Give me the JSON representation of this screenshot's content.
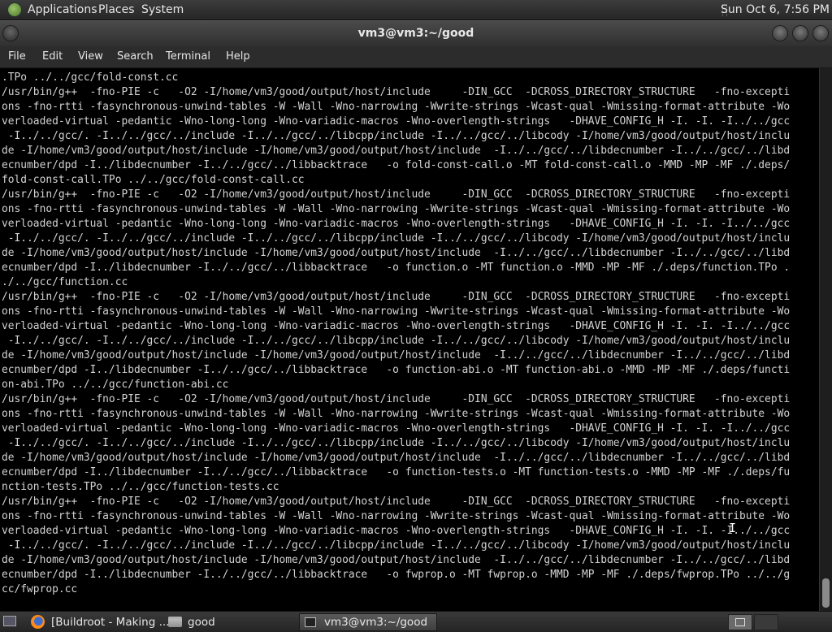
{
  "top_panel": {
    "applications": "Applications",
    "places": "Places",
    "system": "System",
    "clock": "Sun Oct  6,  7:56 PM"
  },
  "window": {
    "title": "vm3@vm3:~/good"
  },
  "menubar": {
    "file": "File",
    "edit": "Edit",
    "view": "View",
    "search": "Search",
    "terminal": "Terminal",
    "help": "Help"
  },
  "terminal": {
    "output": ".TPo ../../gcc/fold-const.cc\n/usr/bin/g++  -fno-PIE -c   -O2 -I/home/vm3/good/output/host/include     -DIN_GCC  -DCROSS_DIRECTORY_STRUCTURE   -fno-excepti\nons -fno-rtti -fasynchronous-unwind-tables -W -Wall -Wno-narrowing -Wwrite-strings -Wcast-qual -Wmissing-format-attribute -Wo\nverloaded-virtual -pedantic -Wno-long-long -Wno-variadic-macros -Wno-overlength-strings   -DHAVE_CONFIG_H -I. -I. -I../../gcc\n -I../../gcc/. -I../../gcc/../include -I../../gcc/../libcpp/include -I../../gcc/../libcody -I/home/vm3/good/output/host/inclu\nde -I/home/vm3/good/output/host/include -I/home/vm3/good/output/host/include  -I../../gcc/../libdecnumber -I../../gcc/../libd\necnumber/dpd -I../libdecnumber -I../../gcc/../libbacktrace   -o fold-const-call.o -MT fold-const-call.o -MMD -MP -MF ./.deps/\nfold-const-call.TPo ../../gcc/fold-const-call.cc\n/usr/bin/g++  -fno-PIE -c   -O2 -I/home/vm3/good/output/host/include     -DIN_GCC  -DCROSS_DIRECTORY_STRUCTURE   -fno-excepti\nons -fno-rtti -fasynchronous-unwind-tables -W -Wall -Wno-narrowing -Wwrite-strings -Wcast-qual -Wmissing-format-attribute -Wo\nverloaded-virtual -pedantic -Wno-long-long -Wno-variadic-macros -Wno-overlength-strings   -DHAVE_CONFIG_H -I. -I. -I../../gcc\n -I../../gcc/. -I../../gcc/../include -I../../gcc/../libcpp/include -I../../gcc/../libcody -I/home/vm3/good/output/host/inclu\nde -I/home/vm3/good/output/host/include -I/home/vm3/good/output/host/include  -I../../gcc/../libdecnumber -I../../gcc/../libd\necnumber/dpd -I../libdecnumber -I../../gcc/../libbacktrace   -o function.o -MT function.o -MMD -MP -MF ./.deps/function.TPo .\n./../gcc/function.cc\n/usr/bin/g++  -fno-PIE -c   -O2 -I/home/vm3/good/output/host/include     -DIN_GCC  -DCROSS_DIRECTORY_STRUCTURE   -fno-excepti\nons -fno-rtti -fasynchronous-unwind-tables -W -Wall -Wno-narrowing -Wwrite-strings -Wcast-qual -Wmissing-format-attribute -Wo\nverloaded-virtual -pedantic -Wno-long-long -Wno-variadic-macros -Wno-overlength-strings   -DHAVE_CONFIG_H -I. -I. -I../../gcc\n -I../../gcc/. -I../../gcc/../include -I../../gcc/../libcpp/include -I../../gcc/../libcody -I/home/vm3/good/output/host/inclu\nde -I/home/vm3/good/output/host/include -I/home/vm3/good/output/host/include  -I../../gcc/../libdecnumber -I../../gcc/../libd\necnumber/dpd -I../libdecnumber -I../../gcc/../libbacktrace   -o function-abi.o -MT function-abi.o -MMD -MP -MF ./.deps/functi\non-abi.TPo ../../gcc/function-abi.cc\n/usr/bin/g++  -fno-PIE -c   -O2 -I/home/vm3/good/output/host/include     -DIN_GCC  -DCROSS_DIRECTORY_STRUCTURE   -fno-excepti\nons -fno-rtti -fasynchronous-unwind-tables -W -Wall -Wno-narrowing -Wwrite-strings -Wcast-qual -Wmissing-format-attribute -Wo\nverloaded-virtual -pedantic -Wno-long-long -Wno-variadic-macros -Wno-overlength-strings   -DHAVE_CONFIG_H -I. -I. -I../../gcc\n -I../../gcc/. -I../../gcc/../include -I../../gcc/../libcpp/include -I../../gcc/../libcody -I/home/vm3/good/output/host/inclu\nde -I/home/vm3/good/output/host/include -I/home/vm3/good/output/host/include  -I../../gcc/../libdecnumber -I../../gcc/../libd\necnumber/dpd -I../libdecnumber -I../../gcc/../libbacktrace   -o function-tests.o -MT function-tests.o -MMD -MP -MF ./.deps/fu\nnction-tests.TPo ../../gcc/function-tests.cc\n/usr/bin/g++  -fno-PIE -c   -O2 -I/home/vm3/good/output/host/include     -DIN_GCC  -DCROSS_DIRECTORY_STRUCTURE   -fno-excepti\nons -fno-rtti -fasynchronous-unwind-tables -W -Wall -Wno-narrowing -Wwrite-strings -Wcast-qual -Wmissing-format-attribute -Wo\nverloaded-virtual -pedantic -Wno-long-long -Wno-variadic-macros -Wno-overlength-strings   -DHAVE_CONFIG_H -I. -I. -I../../gcc\n -I../../gcc/. -I../../gcc/../include -I../../gcc/../libcpp/include -I../../gcc/../libcody -I/home/vm3/good/output/host/inclu\nde -I/home/vm3/good/output/host/include -I/home/vm3/good/output/host/include  -I../../gcc/../libdecnumber -I../../gcc/../libd\necnumber/dpd -I../libdecnumber -I../../gcc/../libbacktrace   -o fwprop.o -MT fwprop.o -MMD -MP -MF ./.deps/fwprop.TPo ../../g\ncc/fwprop.cc",
    "text_color": "#d3d3d3",
    "background": "#000000"
  },
  "taskbar": {
    "tasks": [
      {
        "label": "[Buildroot - Making ...",
        "icon": "firefox-icon"
      },
      {
        "label": "good",
        "icon": "folder-icon"
      },
      {
        "label": "vm3@vm3:~/good",
        "icon": "terminal-icon"
      }
    ]
  }
}
